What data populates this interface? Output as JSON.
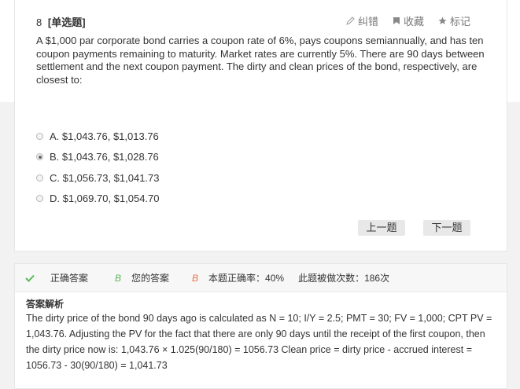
{
  "question": {
    "number": "8",
    "type": "[单选题]",
    "text": "A $1,000 par corporate bond carries a coupon rate of 6%, pays coupons semiannually, and has ten coupon payments remaining to maturity. Market rates are currently 5%. There are 90 days between settlement and the next coupon payment. The dirty and clean prices of the bond, respectively, are closest to:",
    "tools": {
      "correction": "纠错",
      "favorite": "收藏",
      "mark": "标记"
    },
    "options": [
      {
        "label": "A. $1,043.76, $1,013.76",
        "selected": false
      },
      {
        "label": "B. $1,043.76, $1,028.76",
        "selected": true
      },
      {
        "label": "C. $1,056.73, $1,041.73",
        "selected": false
      },
      {
        "label": "D. $1,069.70, $1,054.70",
        "selected": false
      }
    ],
    "prev_label": "上一题",
    "next_label": "下一题"
  },
  "answer": {
    "correct_label": "正确答案",
    "correct_value": "B",
    "yours_label": "您的答案",
    "yours_value": "B",
    "rate_text": "本题正确率：40%",
    "count_text": "此题被做次数：186次",
    "analysis_title": "答案解析",
    "analysis_text": "The dirty price of the bond 90 days ago is calculated as N = 10; I/Y = 2.5; PMT = 30; FV = 1,000; CPT PV = 1,043.76. Adjusting the PV for the fact that there are only 90 days until the receipt of the first coupon, then the dirty price now is: 1,043.76 × 1.025(90/180) = 1056.73 Clean price = dirty price - accrued interest = 1056.73 - 30(90/180) = 1,041.73"
  },
  "colors": {
    "correct": "#5cb85c",
    "yours": "#5cb85c",
    "accent": "#e8734a"
  },
  "icons": {
    "correction": "pencil-icon",
    "favorite": "bookmark-icon",
    "mark": "star-icon",
    "correct": "check-icon"
  }
}
